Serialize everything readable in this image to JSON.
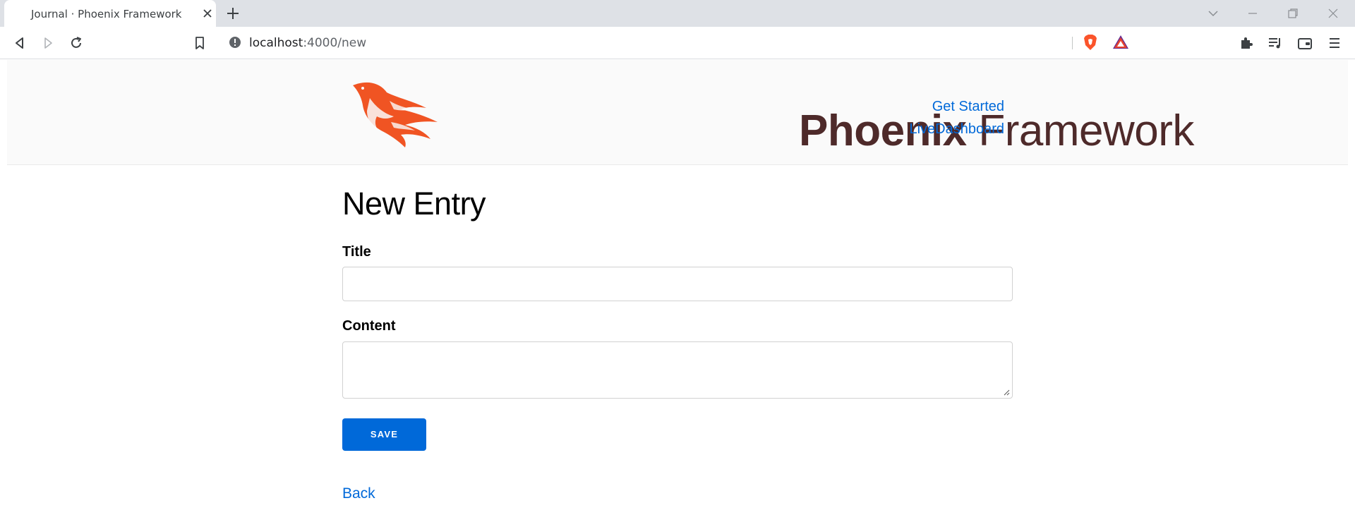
{
  "browser": {
    "tab_title": "Journal · Phoenix Framework",
    "url_host": "localhost",
    "url_path": ":4000/new",
    "icons": [
      "back-icon",
      "forward-icon",
      "reload-icon",
      "bookmark-icon",
      "info-icon",
      "brave-shields-icon",
      "brave-rewards-icon",
      "extensions-icon",
      "media-queue-icon",
      "wallet-icon",
      "menu-icon",
      "tab-search-icon",
      "minimize-icon",
      "restore-icon",
      "close-window-icon"
    ]
  },
  "header": {
    "logo_bold": "Phoenix",
    "logo_light": " Framework",
    "nav": [
      "Get Started",
      "LiveDashboard"
    ]
  },
  "main": {
    "title": "New Entry",
    "fields": [
      {
        "label": "Title",
        "value": ""
      },
      {
        "label": "Content",
        "value": ""
      }
    ],
    "save_label": "SAVE",
    "back_label": "Back"
  },
  "colors": {
    "accent": "#0069d9",
    "logo_flame": "#f05423",
    "logo_text": "#4e2a2a"
  }
}
